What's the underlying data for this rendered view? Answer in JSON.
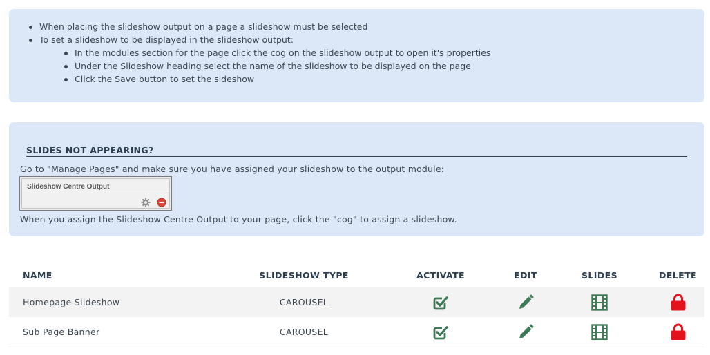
{
  "info": {
    "bullet_1": "When placing the slideshow output on a page a slideshow must be selected",
    "bullet_2": "To set a slideshow to be displayed in the slideshow output:",
    "sub_bullets": [
      "In the modules section for the page click the cog on the slideshow output to open it's properties",
      "Under the Slideshow heading select the name of the slideshow to be displayed on the page",
      "Click the Save button to set the sideshow"
    ]
  },
  "help": {
    "title": "SLIDES NOT APPEARING?",
    "line_1": "Go to \"Manage Pages\" and make sure you have assigned your slideshow to the output module:",
    "module_title": "Slideshow Centre Output",
    "line_2": "When you assign the Slideshow Centre Output to your page, click the \"cog\" to assign a slideshow."
  },
  "table": {
    "headers": {
      "name": "NAME",
      "type": "SLIDESHOW TYPE",
      "activate": "ACTIVATE",
      "edit": "EDIT",
      "slides": "SLIDES",
      "delete": "DELETE"
    },
    "rows": [
      {
        "name": "Homepage Slideshow",
        "type": "CAROUSEL"
      },
      {
        "name": "Sub Page Banner",
        "type": "CAROUSEL"
      }
    ]
  },
  "icons": {
    "activate": "check-square-icon",
    "edit": "pencil-icon",
    "slides": "film-icon",
    "delete": "lock-icon",
    "cog": "cog-icon",
    "remove": "remove-icon"
  },
  "colors": {
    "panel_bg": "#dce8f8",
    "action_green": "#3f7a57",
    "delete_red": "#e4121b",
    "heading": "#2c3e50"
  }
}
